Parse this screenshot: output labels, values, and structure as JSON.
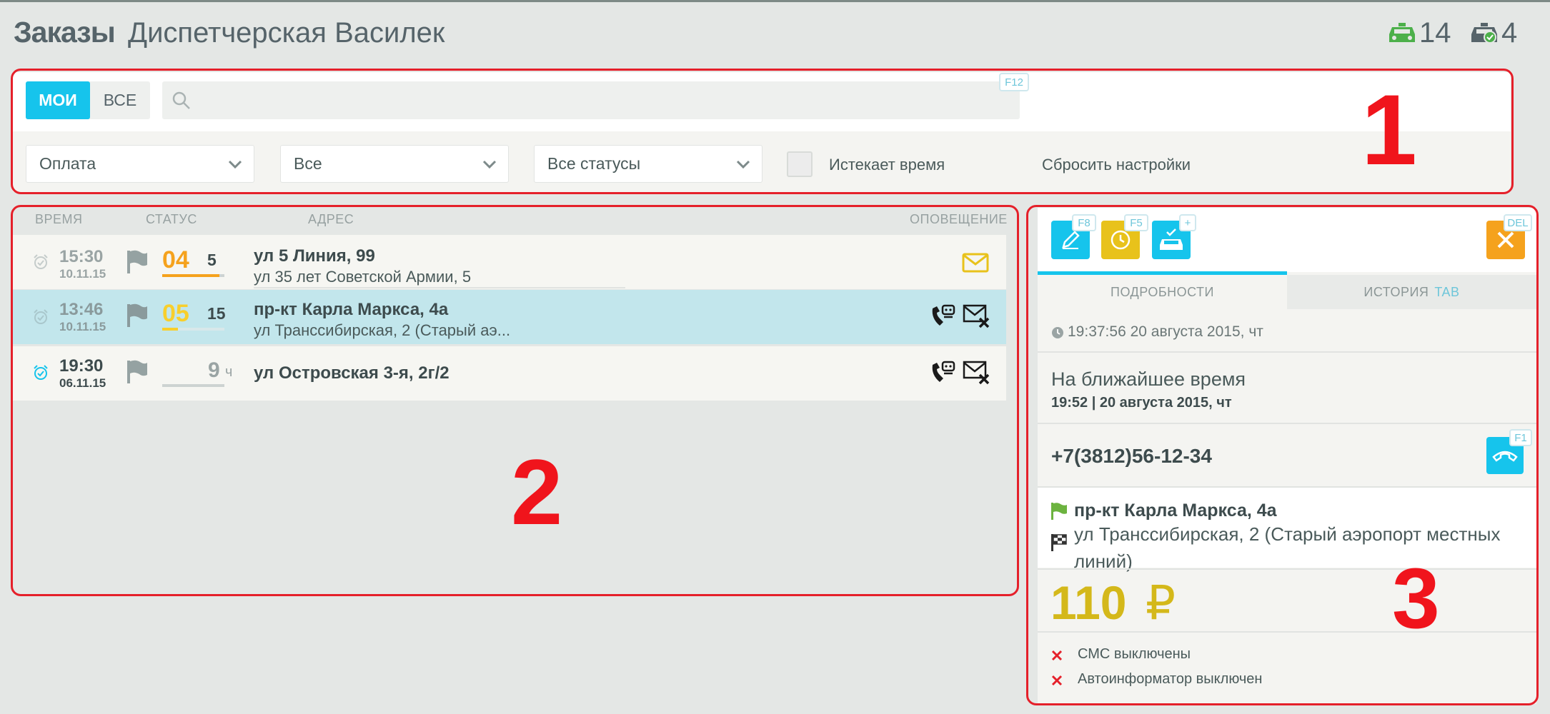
{
  "header": {
    "title": "Заказы",
    "subtitle": "Диспетчерская Василек",
    "free_cars": "14",
    "busy_cars": "4",
    "colors": {
      "free_car": "#4cb04a",
      "busy_car": "#56646a"
    }
  },
  "filters": {
    "tab_mine": "МОИ",
    "tab_all": "ВСЕ",
    "search_placeholder": "",
    "search_hotkey": "F12",
    "payment_select": "Оплата",
    "all_select": "Все",
    "status_select": "Все статусы",
    "expiring_label": "Истекает время",
    "reset_label": "Сбросить настройки"
  },
  "orders": {
    "columns": {
      "time": "ВРЕМЯ",
      "status": "СТАТУС",
      "address": "АДРЕС",
      "notify": "ОПОВЕЩЕНИЕ"
    },
    "rows": [
      {
        "time": "15:30",
        "date": "10.11.15",
        "status_num": "04",
        "status_small": "5",
        "status_color": "#f5a21d",
        "address": "ул 5 Линия, 99",
        "address_to": "ул 35 лет Советской Армии, 5",
        "notify_icons": [
          "mail-icon"
        ]
      },
      {
        "time": "13:46",
        "date": "10.11.15",
        "status_num": "05",
        "status_small": "15",
        "status_color": "#f8cf2c",
        "address": "пр-кт Карла Маркса, 4а",
        "address_to": "ул Транссибирская, 2 (Старый аэ...",
        "notify_icons": [
          "robot-call-icon",
          "mail-off-icon"
        ]
      },
      {
        "time": "19:30",
        "date": "06.11.15",
        "status_num": "9",
        "status_small": "ч",
        "status_color": "#9aa4a4",
        "address": "ул Островская 3-я, 2г/2",
        "address_to": "",
        "notify_icons": [
          "robot-call-icon",
          "mail-off-icon"
        ]
      }
    ]
  },
  "detail": {
    "hotkeys": {
      "edit": "F8",
      "time": "F5",
      "assign": "+",
      "delete": "DEL",
      "call": "F1"
    },
    "tab_details": "ПОДРОБНОСТИ",
    "tab_history": "ИСТОРИЯ",
    "tab_history_key": "TAB",
    "created": "19:37:56 20 августа 2015, чт",
    "time_title": "На ближайшее время",
    "time_value": "19:52 | 20 августа 2015, чт",
    "phone": "+7(3812)56-12-34",
    "from": "пр-кт Карла Маркса, 4а",
    "to": "ул Транссибирская, 2 (Старый аэропорт местных линий)",
    "price": "110",
    "currency": "₽",
    "sms": "СМС выключены",
    "autoinformer": "Автоинформатор выключен",
    "colors": {
      "accent": "#16c4ec",
      "yellow": "#e8c21b",
      "orange": "#f5a21d",
      "price": "#d4b81a",
      "flag_green": "#6cb33f"
    }
  },
  "annotations": {
    "zone1": "1",
    "zone2": "2",
    "zone3": "3"
  }
}
